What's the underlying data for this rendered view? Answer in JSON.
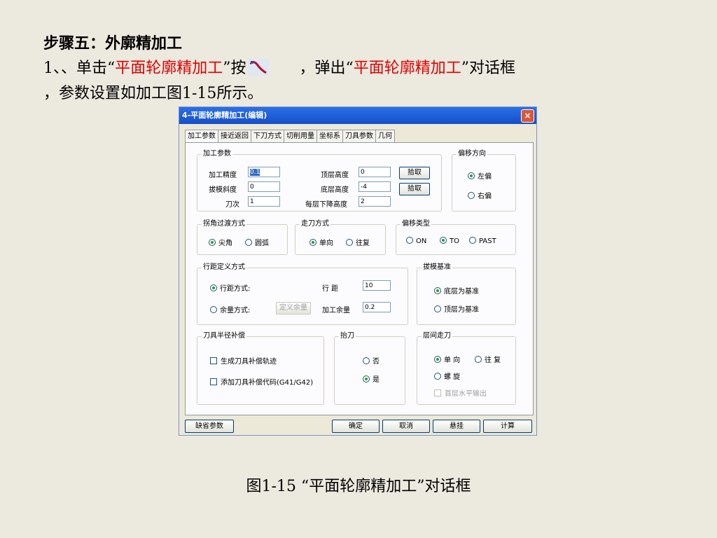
{
  "slide": {
    "step_title": "步骤五：外廓精加工",
    "line1_a": "1、、单击“",
    "line1_red": "平面轮廓精加工",
    "line1_b": "”按",
    "line1_c": "，弹出“",
    "line1_red2": "平面轮廓精加工",
    "line1_d": "”对话框",
    "line2": "，参数设置如加工图1-15所示。",
    "caption": "图1-15 “平面轮廓精加工”对话框",
    "icon": "contour-tool-icon",
    "accent_red": "#e00000"
  },
  "dialog": {
    "title": "4-平面轮廓精加工(编辑)",
    "close": "×",
    "tabs": [
      "加工参数",
      "接近返回",
      "下刀方式",
      "切削用量",
      "坐标系",
      "刀具参数",
      "几何"
    ],
    "machining": {
      "title": "加工参数",
      "precision_label": "加工精度",
      "precision_value": "0.1",
      "draft_label": "拔模斜度",
      "draft_value": "0",
      "passes_label": "刀次",
      "passes_value": "1",
      "top_label": "顶层高度",
      "top_value": "0",
      "bottom_label": "底层高度",
      "bottom_value": "-4",
      "step_label": "每层下降高度",
      "step_value": "2",
      "pick1": "拾取",
      "pick2": "拾取"
    },
    "offset_dir": {
      "title": "偏移方向",
      "left": "左偏",
      "right": "右偏"
    },
    "corner": {
      "title": "拐角过渡方式",
      "sharp": "尖角",
      "arc": "圆弧"
    },
    "walk": {
      "title": "走刀方式",
      "single": "单向",
      "round": "往复"
    },
    "offset_type": {
      "title": "偏移类型",
      "on": "ON",
      "to": "TO",
      "past": "PAST"
    },
    "row": {
      "title": "行距定义方式",
      "spacing_mode": "行距方式:",
      "allowance_mode": "余量方式:",
      "define_btn": "定义余量",
      "spacing_label": "行 距",
      "spacing_value": "10",
      "allow_label": "加工余量",
      "allow_value": "0.2"
    },
    "draft_base": {
      "title": "拔模基准",
      "bottom": "底层为基准",
      "top": "顶层为基准"
    },
    "comp": {
      "title": "刀具半径补偿",
      "gen": "生成刀具补偿轨迹",
      "code": "添加刀具补偿代码(G41/G42)"
    },
    "lift": {
      "title": "抬刀",
      "no": "否",
      "yes": "是"
    },
    "layer": {
      "title": "层间走刀",
      "single": "单 向",
      "round": "往 复",
      "spiral": "螺 旋",
      "first": "首层水平输出"
    },
    "buttons": {
      "default": "缺省参数",
      "ok": "确定",
      "cancel": "取消",
      "hang": "悬挂",
      "calc": "计算"
    }
  }
}
